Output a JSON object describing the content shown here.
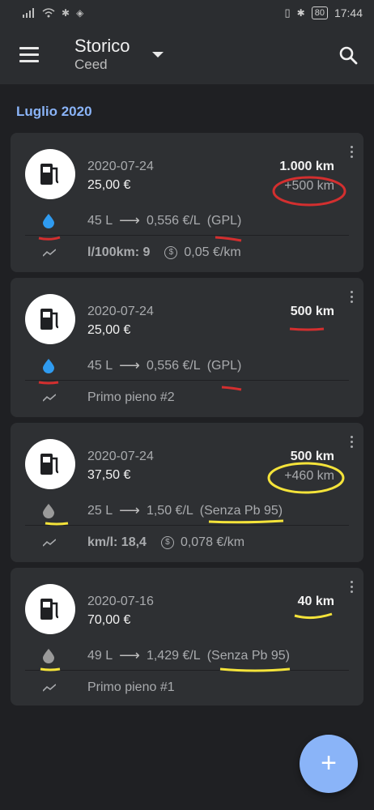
{
  "status_bar": {
    "battery": "80",
    "time": "17:44"
  },
  "toolbar": {
    "title": "Storico",
    "subtitle": "Ceed"
  },
  "section": {
    "title": "Luglio 2020"
  },
  "entries": [
    {
      "date": "2020-07-24",
      "cost": "25,00 €",
      "km": "1.000 km",
      "km_delta": "+500 km",
      "liters": "45 L",
      "price": "0,556 €/L",
      "fuel": "(GPL)",
      "fuel_color": "#2f9bf0",
      "stat_primary": "l/100km: 9",
      "stat_cost": "0,05 €/km",
      "first_fill": ""
    },
    {
      "date": "2020-07-24",
      "cost": "25,00 €",
      "km": "500 km",
      "km_delta": "",
      "liters": "45 L",
      "price": "0,556 €/L",
      "fuel": "(GPL)",
      "fuel_color": "#2f9bf0",
      "stat_primary": "",
      "stat_cost": "",
      "first_fill": "Primo pieno #2"
    },
    {
      "date": "2020-07-24",
      "cost": "37,50 €",
      "km": "500 km",
      "km_delta": "+460 km",
      "liters": "25 L",
      "price": "1,50 €/L",
      "fuel": "(Senza Pb 95)",
      "fuel_color": "#9a9a9a",
      "stat_primary": "km/l: 18,4",
      "stat_cost": "0,078 €/km",
      "first_fill": ""
    },
    {
      "date": "2020-07-16",
      "cost": "70,00 €",
      "km": "40 km",
      "km_delta": "",
      "liters": "49 L",
      "price": "1,429 €/L",
      "fuel": "(Senza Pb 95)",
      "fuel_color": "#9a9a9a",
      "stat_primary": "",
      "stat_cost": "",
      "first_fill": "Primo pieno #1"
    }
  ],
  "icons": {
    "menu": "menu-icon",
    "dropdown": "dropdown-icon",
    "search": "search-icon",
    "pump": "fuel-pump-icon",
    "drop": "drop-icon",
    "trend": "trend-icon",
    "more": "more-vert-icon",
    "add": "add-icon",
    "dollar": "dollar-icon"
  },
  "fab": {
    "label": "+"
  }
}
